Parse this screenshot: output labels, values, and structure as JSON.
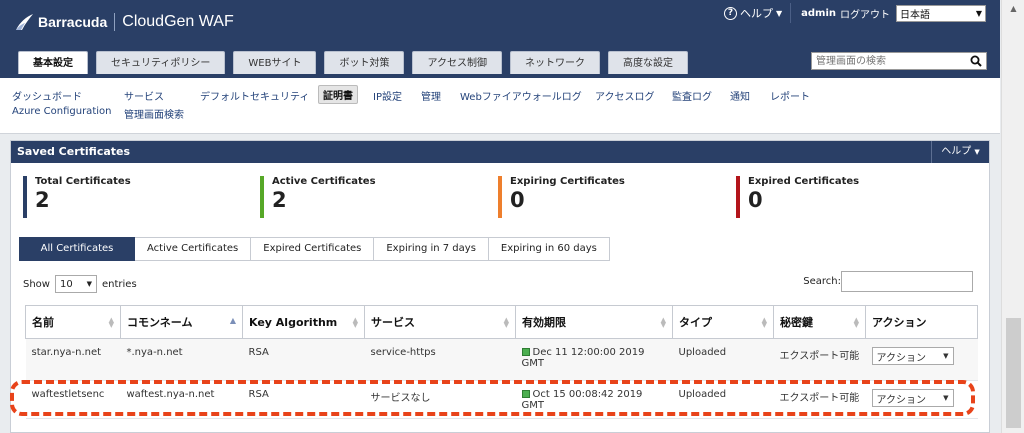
{
  "header": {
    "brand": "Barracuda",
    "product": "CloudGen WAF",
    "help_label": "ヘルプ",
    "user": "admin",
    "logout": "ログアウト",
    "language": "日本語",
    "search_placeholder": "管理画面の検索"
  },
  "main_tabs": [
    "基本設定",
    "セキュリティポリシー",
    "WEBサイト",
    "ボット対策",
    "アクセス制御",
    "ネットワーク",
    "高度な設定"
  ],
  "subnav": {
    "dashboard": "ダッシュボード",
    "services": "サービス",
    "default_security": "デフォルトセキュリティ",
    "certificates": "証明書",
    "ip_config": "IP設定",
    "admin": "管理",
    "web_firewall_log": "Webファイアウォールログ",
    "access_log": "アクセスログ",
    "audit_log": "監査ログ",
    "notification": "通知",
    "reports": "レポート",
    "azure_config": "Azure Configuration",
    "admin_search": "管理画面検索"
  },
  "panel": {
    "title": "Saved Certificates",
    "help": "ヘルプ"
  },
  "stats": {
    "total": {
      "label": "Total Certificates",
      "value": "2",
      "color": "#2a3f66"
    },
    "active": {
      "label": "Active Certificates",
      "value": "2",
      "color": "#56a828"
    },
    "expiring": {
      "label": "Expiring Certificates",
      "value": "0",
      "color": "#ee7f2d"
    },
    "expired": {
      "label": "Expired Certificates",
      "value": "0",
      "color": "#b3151b"
    }
  },
  "filter_tabs": [
    "All Certificates",
    "Active Certificates",
    "Expired Certificates",
    "Expiring in 7 days",
    "Expiring in 60 days"
  ],
  "list_controls": {
    "show": "Show",
    "entries_value": "10",
    "entries": "entries",
    "search": "Search:"
  },
  "table": {
    "columns": [
      "名前",
      "コモンネーム",
      "Key Algorithm",
      "サービス",
      "有効期限",
      "タイプ",
      "秘密鍵",
      "アクション"
    ],
    "rows": [
      {
        "name": "star.nya-n.net",
        "cn": "*.nya-n.net",
        "algo": "RSA",
        "service": "service-https",
        "expiry": "Dec 11 12:00:00 2019 GMT",
        "type": "Uploaded",
        "key": "エクスポート可能",
        "action": "アクション"
      },
      {
        "name": "waftestletsenc",
        "cn": "waftest.nya-n.net",
        "algo": "RSA",
        "service": "サービスなし",
        "expiry": "Oct 15 00:08:42 2019 GMT",
        "type": "Uploaded",
        "key": "エクスポート可能",
        "action": "アクション"
      }
    ]
  }
}
